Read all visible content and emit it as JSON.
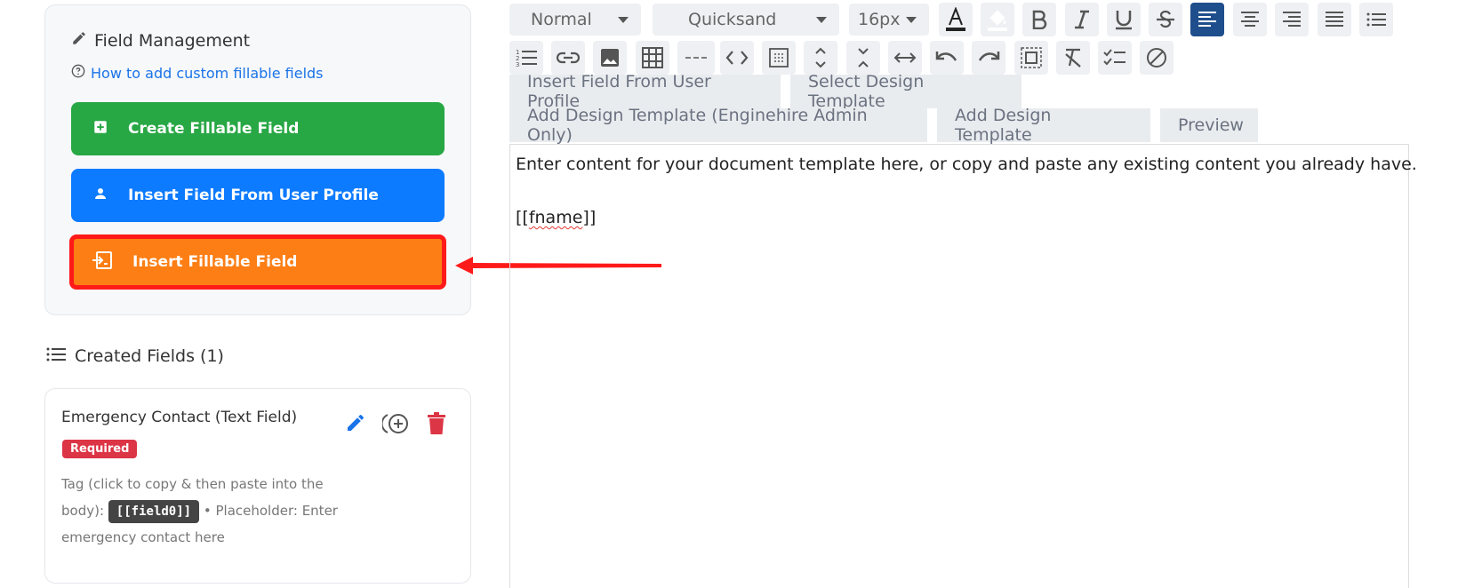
{
  "left": {
    "panel_title": "Field Management",
    "help_link": "How to add custom fillable fields",
    "buttons": {
      "create": "Create Fillable Field",
      "insert_profile": "Insert Field From User Profile",
      "insert_fillable": "Insert Fillable Field"
    },
    "created_title": "Created Fields (1)",
    "field": {
      "name": "Emergency Contact (Text Field)",
      "badge": "Required",
      "tag_prefix": "Tag (click to copy & then paste into the body):",
      "tag": "[[field0]]",
      "placeholder": "• Placeholder: Enter emergency contact here"
    }
  },
  "toolbar": {
    "format_select": "Normal",
    "font_select": "Quicksand",
    "size_select": "16px",
    "icons": [
      "text-color",
      "highlight",
      "bold",
      "italic",
      "underline",
      "strikethrough",
      "align-left",
      "align-center",
      "align-right",
      "align-justify",
      "bullet-list",
      "numbered-list",
      "link",
      "image",
      "table",
      "horizontal-rule",
      "code",
      "box",
      "expand-vertical",
      "collapse-vertical",
      "expand-horizontal",
      "undo",
      "redo",
      "select-all",
      "clear-format",
      "checklist",
      "disable"
    ]
  },
  "tabs": {
    "insert_profile": "Insert Field From User Profile",
    "select_template": "Select Design Template",
    "add_template_admin": "Add Design Template (Enginehire Admin Only)",
    "add_template": "Add Design Template",
    "preview": "Preview"
  },
  "editor": {
    "line1": "Enter content for your document template here, or copy and paste any existing content you already have.",
    "line2_prefix": "[[",
    "line2_word": "fname",
    "line2_suffix": "]]"
  },
  "colors": {
    "green": "#28a745",
    "blue": "#0d7bff",
    "orange": "#fd7e14",
    "highlight_border": "#ff1a1a",
    "badge_red": "#dc3545",
    "active_toolbar": "#1f4e8c"
  }
}
